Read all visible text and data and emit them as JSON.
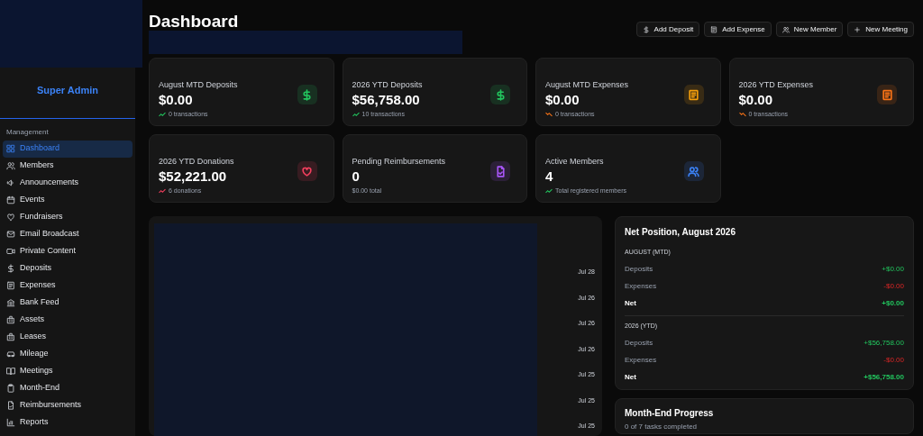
{
  "sidebar": {
    "role": "Super Admin",
    "section": "Management",
    "items": [
      {
        "label": "Dashboard",
        "selected": true
      },
      {
        "label": "Members",
        "selected": false
      },
      {
        "label": "Announcements",
        "selected": false
      },
      {
        "label": "Events",
        "selected": false
      },
      {
        "label": "Fundraisers",
        "selected": false
      },
      {
        "label": "Email Broadcast",
        "selected": false
      },
      {
        "label": "Private Content",
        "selected": false
      },
      {
        "label": "Deposits",
        "selected": false
      },
      {
        "label": "Expenses",
        "selected": false
      },
      {
        "label": "Bank Feed",
        "selected": false
      },
      {
        "label": "Assets",
        "selected": false
      },
      {
        "label": "Leases",
        "selected": false
      },
      {
        "label": "Mileage",
        "selected": false
      },
      {
        "label": "Meetings",
        "selected": false
      },
      {
        "label": "Month-End",
        "selected": false
      },
      {
        "label": "Reimbursements",
        "selected": false
      },
      {
        "label": "Reports",
        "selected": false
      }
    ]
  },
  "header": {
    "title": "Dashboard",
    "actions": [
      "Add Deposit",
      "Add Expense",
      "New Member",
      "New Meeting"
    ]
  },
  "stats": [
    {
      "label": "August MTD Deposits",
      "value": "$0.00",
      "note": "0 transactions",
      "kind": "rising",
      "color": "#22c55e"
    },
    {
      "label": "2026 YTD Deposits",
      "value": "$56,758.00",
      "note": "10 transactions",
      "kind": "rising",
      "color": "#22c55e"
    },
    {
      "label": "August MTD Expenses",
      "value": "$0.00",
      "note": "0 transactions",
      "kind": "falling",
      "color": "#f59e0b"
    },
    {
      "label": "2026 YTD Expenses",
      "value": "$0.00",
      "note": "0 transactions",
      "kind": "falling",
      "color": "#f97316"
    },
    {
      "label": "2026 YTD Donations",
      "value": "$52,221.00",
      "note": "6 donations",
      "kind": "rising",
      "color": "#f43f5e"
    },
    {
      "label": "Pending Reimbursements",
      "value": "0",
      "note": "$0.00 total",
      "kind": "plain",
      "color": "#a855f7"
    },
    {
      "label": "Active Members",
      "value": "4",
      "note": "Total registered members",
      "kind": "rising",
      "color": "#3b82f6"
    }
  ],
  "timeline_dates": [
    "Jul 28",
    "Jul 26",
    "Jul 26",
    "Jul 26",
    "Jul 25",
    "Jul 25",
    "Jul 25"
  ],
  "net_position": {
    "title": "Net Position, August 2026",
    "sections": [
      {
        "heading": "AUGUST (MTD)",
        "rows": [
          {
            "label": "Deposits",
            "value": "+$0.00",
            "kind": "gain"
          },
          {
            "label": "Expenses",
            "value": "-$0.00",
            "kind": "loss"
          },
          {
            "label": "Net",
            "value": "+$0.00",
            "kind": "total"
          }
        ]
      },
      {
        "heading": "2026 (YTD)",
        "rows": [
          {
            "label": "Deposits",
            "value": "+$56,758.00",
            "kind": "gain"
          },
          {
            "label": "Expenses",
            "value": "-$0.00",
            "kind": "loss"
          },
          {
            "label": "Net",
            "value": "+$56,758.00",
            "kind": "total"
          }
        ]
      }
    ]
  },
  "month_end": {
    "title": "Month-End Progress",
    "note": "0 of 7 tasks completed"
  }
}
